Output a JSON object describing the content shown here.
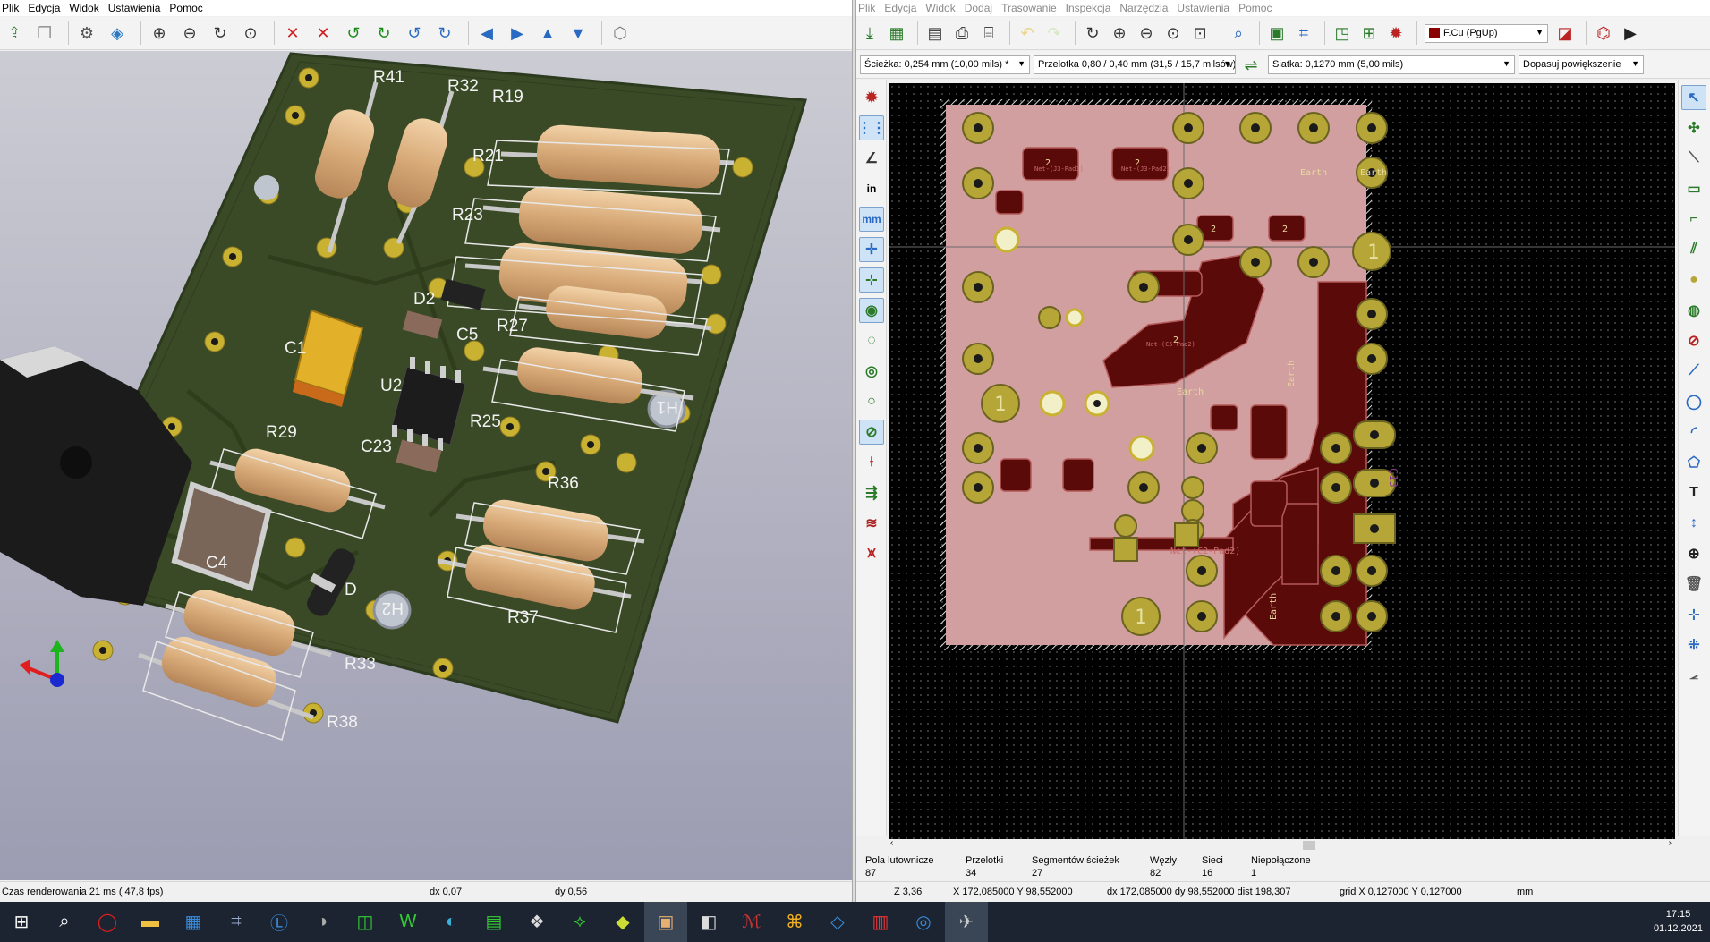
{
  "left_window": {
    "menu": [
      "Plik",
      "Edycja",
      "Widok",
      "Ustawienia",
      "Pomoc"
    ],
    "toolbar_icons": [
      "reload-board-icon",
      "copy-image-icon",
      "settings-gear-icon",
      "3d-cube-view-icon",
      "zoom-in-icon",
      "zoom-out-icon",
      "redraw-icon",
      "zoom-fit-icon",
      "rotate-x-cw-icon",
      "rotate-x-ccw-icon",
      "rotate-y-cw-icon",
      "rotate-y-ccw-icon",
      "rotate-z-cw-icon",
      "rotate-z-ccw-icon",
      "move-left-icon",
      "move-right-icon",
      "move-up-icon",
      "move-down-icon",
      "ortho-view-icon"
    ],
    "view3d": {
      "components": [
        "R41",
        "R32",
        "R19",
        "R21",
        "R23",
        "D2",
        "C5",
        "R27",
        "C1",
        "U2",
        "R25",
        "R29",
        "C23",
        "R36",
        "H1",
        "C4",
        "D",
        "R37",
        "R33",
        "R38",
        "H2"
      ]
    },
    "status": {
      "render_time": "Czas renderowania 21 ms ( 47,8 fps)",
      "dx": "dx 0,07",
      "dy": "dy 0,56"
    }
  },
  "right_window": {
    "menu": [
      "Plik",
      "Edycja",
      "Widok",
      "Dodaj",
      "Trasowanie",
      "Inspekcja",
      "Narzędzia",
      "Ustawienia",
      "Pomoc"
    ],
    "toolbar_icons": [
      "save-icon",
      "board-setup-icon",
      "page-setup-icon",
      "print-icon",
      "plot-icon",
      "undo-icon",
      "redo-icon",
      "redraw-icon",
      "zoom-in-icon",
      "zoom-out-icon",
      "zoom-fit-icon",
      "zoom-selection-icon",
      "find-icon",
      "netlist-icon",
      "footprint-editor-icon",
      "net-inspector-icon",
      "footprint-browser-icon",
      "drc-icon"
    ],
    "layer_select": "F.Cu (PgUp)",
    "layer_color": "#8b0000",
    "track": "Ścieżka: 0,254 mm (10,00 mils) *",
    "via": "Przelotka 0,80 / 0,40 mm (31,5 / 15,7 milsów) *",
    "grid": "Siatka: 0,1270 mm (5,00 mils)",
    "zoom": "Dopasuj powiększenie",
    "left_tools": [
      "drc-marker-icon",
      "grid-icon",
      "polar-coords-icon",
      "units-in-icon",
      "units-mm-icon",
      "cursor-shape-icon",
      "show-ratsnest-icon",
      "zone-fill-icon",
      "zone-outline-icon",
      "zone-nofill-icon",
      "pad-sketch-icon",
      "via-sketch-icon",
      "track-sketch-icon",
      "track-width-icon",
      "layers-manager-icon",
      "microwave-icon"
    ],
    "left_labels": {
      "in": "in",
      "mm": "mm"
    },
    "right_tools": [
      "select-arrow-icon",
      "highlight-net-icon",
      "local-ratsnest-icon",
      "add-footprint-icon",
      "route-track-icon",
      "route-diff-pair-icon",
      "add-via-icon",
      "add-zone-icon",
      "add-keepout-icon",
      "draw-line-icon",
      "draw-circle-icon",
      "draw-arc-icon",
      "draw-polygon-icon",
      "add-text-icon",
      "add-dimension-icon",
      "add-target-icon",
      "delete-icon",
      "set-origin-icon",
      "grid-origin-icon",
      "measure-icon"
    ],
    "text_tool_label": "T",
    "pcb": {
      "net_labels": [
        "Net-(C2-Pad2)",
        "Net-(C5-Pad2)",
        "Net-(C4-Pad1)",
        "Net-(C23-Pad1)",
        "Net-(J3-Pad1)",
        "Net-(J3-Pad2)"
      ],
      "earth_label": "Earth",
      "pad_numbers": [
        "1",
        "2"
      ],
      "ref_rotated": "C13"
    },
    "messages": [
      {
        "label": "Pola lutownicze",
        "value": "87"
      },
      {
        "label": "Przelotki",
        "value": "34"
      },
      {
        "label": "Segmentów ścieżek",
        "value": "27"
      },
      {
        "label": "Węzły",
        "value": "82"
      },
      {
        "label": "Sieci",
        "value": "16"
      },
      {
        "label": "Niepołączone",
        "value": "1"
      }
    ],
    "status": {
      "zoom": "Z 3,36",
      "xy": "X 172,085000  Y 98,552000",
      "dxdy": "dx 172,085000  dy 98,552000  dist 198,307",
      "grid": "grid X 0,127000  Y 0,127000",
      "units": "mm"
    }
  },
  "taskbar": {
    "apps": [
      "windows-start-icon",
      "search-icon",
      "opera-icon",
      "file-explorer-icon",
      "calculator-icon",
      "kicad-schematic-icon",
      "libreoffice-icon",
      "app-icon",
      "green-app-icon",
      "winword-icon",
      "edge-icon",
      "spreadsheet-icon",
      "krita-icon",
      "gerbview-icon",
      "app-icon-2",
      "kicad-pcb-icon",
      "notepad-icon",
      "kicad-icon",
      "pdf-icon",
      "vscode-icon",
      "blue-app-icon",
      "kicad-3d-icon"
    ],
    "time": "17:15",
    "date": "01.12.2021"
  }
}
